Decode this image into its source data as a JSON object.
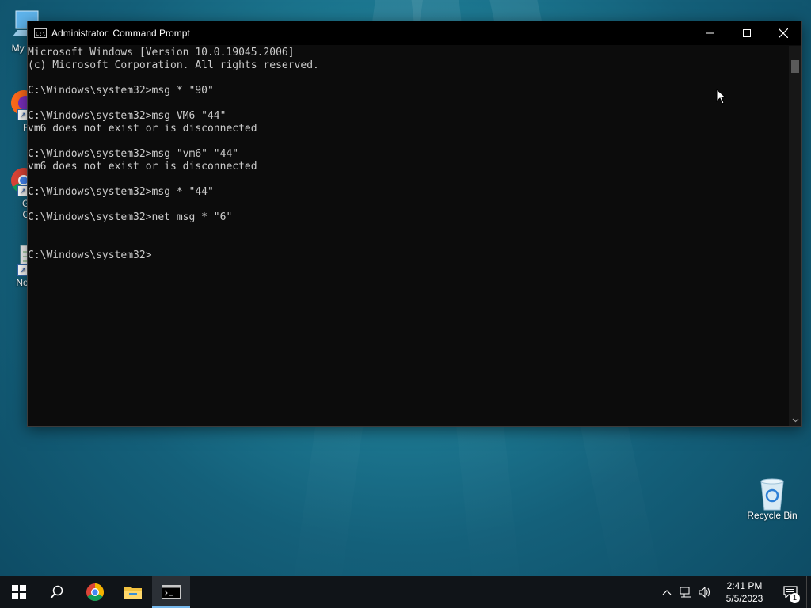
{
  "desktop": {
    "icons": [
      {
        "label": "My Co"
      },
      {
        "label": "Fir"
      },
      {
        "label": "Go Ch"
      },
      {
        "label": "Note"
      },
      {
        "label": "Recycle Bin"
      }
    ]
  },
  "window": {
    "title": "Administrator: Command Prompt",
    "icon_text": "C:\\",
    "console_lines": [
      "Microsoft Windows [Version 10.0.19045.2006]",
      "(c) Microsoft Corporation. All rights reserved.",
      "",
      "C:\\Windows\\system32>msg * \"90\"",
      "",
      "C:\\Windows\\system32>msg VM6 \"44\"",
      "vm6 does not exist or is disconnected",
      "",
      "C:\\Windows\\system32>msg \"vm6\" \"44\"",
      "vm6 does not exist or is disconnected",
      "",
      "C:\\Windows\\system32>msg * \"44\"",
      "",
      "C:\\Windows\\system32>net msg * \"6\"",
      "",
      "",
      "C:\\Windows\\system32>"
    ]
  },
  "taskbar": {
    "clock_time": "2:41 PM",
    "clock_date": "5/5/2023",
    "notification_count": "1",
    "accent_color": "#76b9ed"
  }
}
